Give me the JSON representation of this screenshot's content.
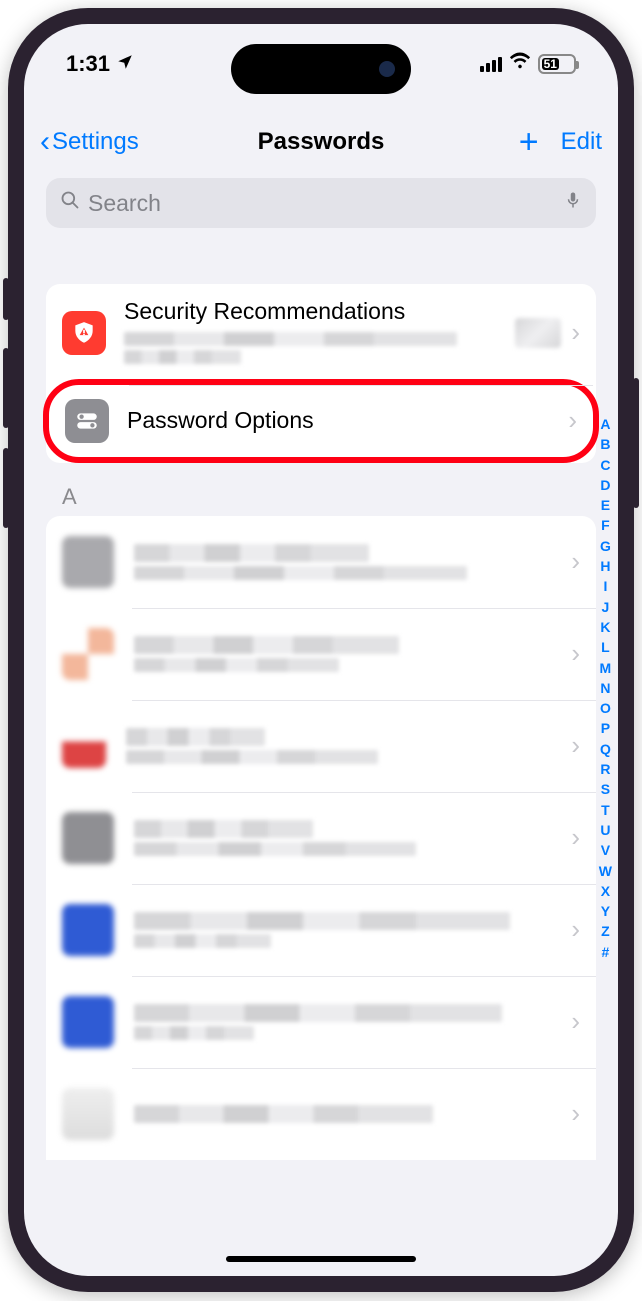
{
  "status": {
    "time": "1:31",
    "battery": "51"
  },
  "nav": {
    "back_label": "Settings",
    "title": "Passwords",
    "add_label": "+",
    "edit_label": "Edit"
  },
  "search": {
    "placeholder": "Search"
  },
  "options_card": {
    "security": {
      "title": "Security Recommenda­tions"
    },
    "password_options": {
      "title": "Password Options"
    }
  },
  "section_header": "A",
  "index_letters": [
    "A",
    "B",
    "C",
    "D",
    "E",
    "F",
    "G",
    "H",
    "I",
    "J",
    "K",
    "L",
    "M",
    "N",
    "O",
    "P",
    "Q",
    "R",
    "S",
    "T",
    "U",
    "V",
    "W",
    "X",
    "Y",
    "Z",
    "#"
  ]
}
